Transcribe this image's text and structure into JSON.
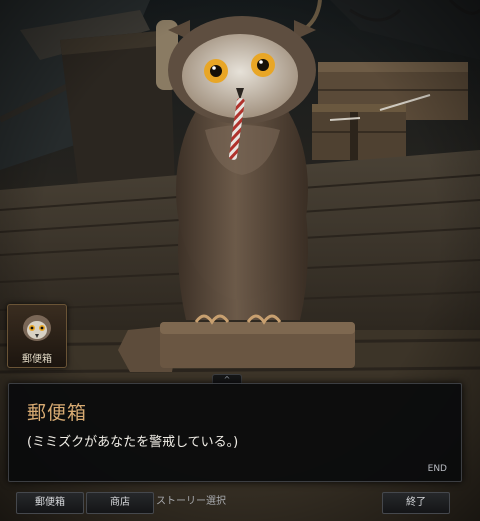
{
  "npc": {
    "portrait_label": "郵便箱",
    "name": "郵便箱",
    "dialog_text": "(ミミズクがあなたを警戒している。)",
    "end_label": "END"
  },
  "dialog": {
    "expand_glyph": "^"
  },
  "bottom_bar": {
    "mailbox_button": "郵便箱",
    "shop_button": "商店",
    "story_select_label": "ストーリー選択",
    "exit_button": "終了"
  },
  "colors": {
    "npc_name": "#d7aa72",
    "dialog_text": "#f0ede6",
    "panel_background": "#0a0b0c",
    "owl_eye": "#e8a626"
  }
}
